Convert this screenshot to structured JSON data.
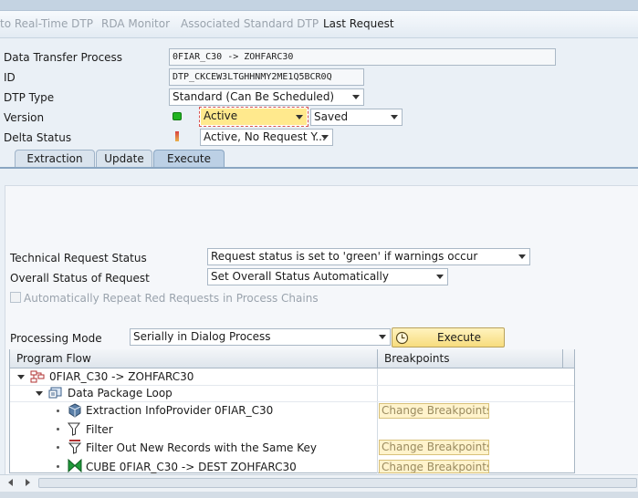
{
  "toolbar": {
    "items": [
      "to Real-Time DTP",
      "RDA Monitor",
      "Associated Standard DTP",
      "Last Request"
    ]
  },
  "header": {
    "dtp_label": "Data Transfer Process",
    "dtp_value": "0FIAR_C30 -> ZOHFARC30",
    "id_label": "ID",
    "id_value": "DTP_CKCEW3LTGHHNMY2ME1Q5BCR0Q",
    "type_label": "DTP Type",
    "type_value": "Standard (Can Be Scheduled)",
    "version_label": "Version",
    "version_value": "Active",
    "version_save_value": "Saved",
    "delta_label": "Delta Status",
    "delta_value": "Active, No Request Y..."
  },
  "tabs": [
    "Extraction",
    "Update",
    "Execute"
  ],
  "execute": {
    "tech_status_label": "Technical Request Status",
    "tech_status_value": "Request status is set to 'green' if warnings occur",
    "overall_status_label": "Overall Status of Request",
    "overall_status_value": "Set Overall Status Automatically",
    "auto_repeat_label": "Automatically Repeat Red Requests in Process Chains",
    "processing_mode_label": "Processing Mode",
    "processing_mode_value": "Serially in Dialog Process",
    "execute_button": "Execute"
  },
  "tree": {
    "columns": [
      "Program Flow",
      "Breakpoints"
    ],
    "rows": [
      {
        "text": "0FIAR_C30 -> ZOHFARC30",
        "icon": "process-icon",
        "breakpoint": ""
      },
      {
        "text": "Data Package Loop",
        "icon": "loop-icon",
        "breakpoint": ""
      },
      {
        "text": "Extraction InfoProvider 0FIAR_C30",
        "icon": "cube-icon",
        "breakpoint": "Change Breakpoints"
      },
      {
        "text": "Filter",
        "icon": "filter-icon",
        "breakpoint": ""
      },
      {
        "text": "Filter Out New Records with the Same Key",
        "icon": "filter-key-icon",
        "breakpoint": "Change Breakpoints"
      },
      {
        "text": "CUBE 0FIAR_C30 -> DEST ZOHFARC30",
        "icon": "transformation-icon",
        "breakpoint": "Change Breakpoints"
      }
    ]
  },
  "colors": {
    "accent": "#bcd0e5",
    "button_yellow": "#f7dc7d",
    "status_green": "#21b321",
    "focus_red": "#d9534f"
  }
}
